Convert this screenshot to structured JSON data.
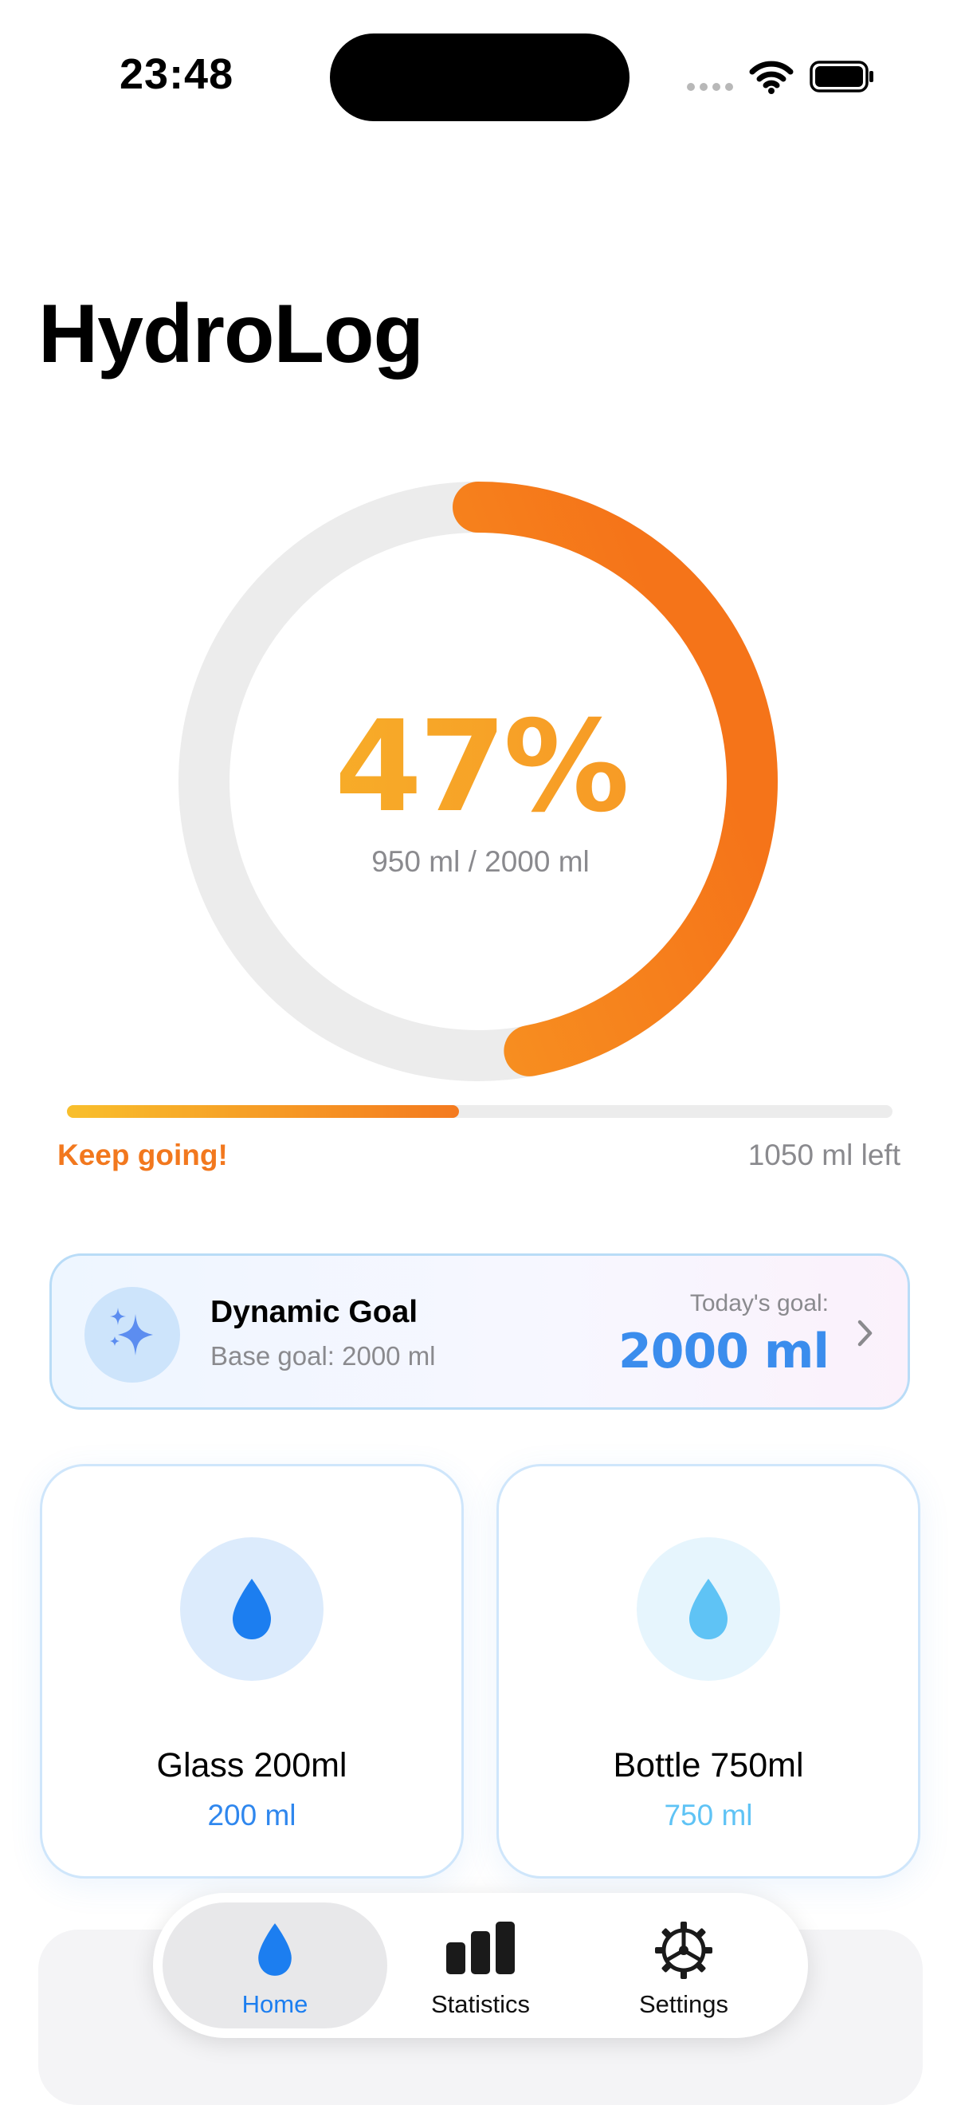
{
  "status_bar": {
    "time": "23:48",
    "icons": [
      "cellular-dots-icon",
      "wifi-icon",
      "battery-icon"
    ]
  },
  "app": {
    "title": "HydroLog"
  },
  "progress": {
    "percent_text": "47%",
    "percent_value": 47,
    "amount_text": "950 ml / 2000 ml",
    "linear_fraction": 0.475,
    "status_text": "Keep going!",
    "remaining_text": "1050 ml left",
    "colors": {
      "gradient_start": "#f8c02a",
      "gradient_end": "#f47a1f",
      "track": "#ececec"
    }
  },
  "goal_card": {
    "icon": "sparkles-icon",
    "title": "Dynamic Goal",
    "subtitle": "Base goal: 2000 ml",
    "today_label": "Today's goal:",
    "today_value": "2000 ml",
    "accent_color": "#3b8ded"
  },
  "drinks": [
    {
      "name": "Glass 200ml",
      "amount": "200 ml",
      "icon": "water-drop-icon",
      "color": "#1c7ef0"
    },
    {
      "name": "Bottle 750ml",
      "amount": "750 ml",
      "icon": "water-drop-icon",
      "color": "#5fc3f5"
    }
  ],
  "tab_bar": {
    "active": "Home",
    "tabs": [
      {
        "label": "Home",
        "icon": "water-drop-icon"
      },
      {
        "label": "Statistics",
        "icon": "bar-chart-icon"
      },
      {
        "label": "Settings",
        "icon": "gear-icon"
      }
    ],
    "active_color": "#1c7ef0"
  }
}
